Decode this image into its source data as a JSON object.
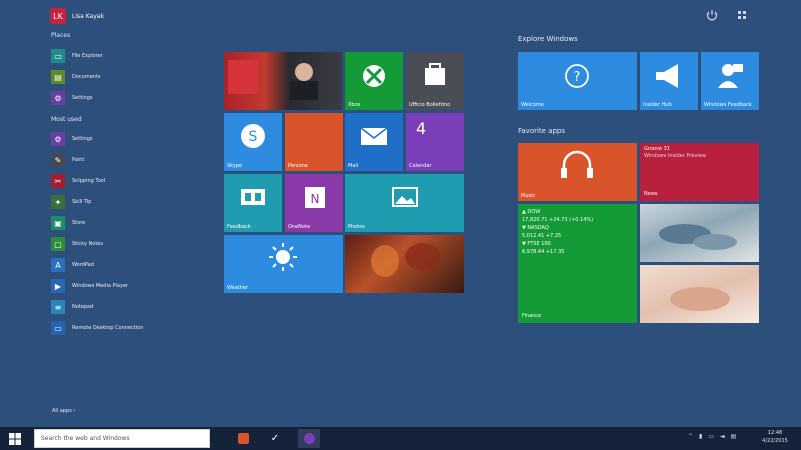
{
  "user": {
    "name": "Lisa Kayak",
    "avatar_initials": "LK"
  },
  "left_menu": {
    "sections": [
      {
        "title": "Places",
        "items": [
          {
            "label": "File Explorer",
            "icon": "folder-icon",
            "color": "#1e8d8a"
          },
          {
            "label": "Documents",
            "icon": "documents-icon",
            "color": "#5f8a2b"
          },
          {
            "label": "Settings",
            "icon": "gear-icon",
            "color": "#6b3fa0"
          }
        ]
      },
      {
        "title": "Most used",
        "items": [
          {
            "label": "Settings",
            "icon": "gear-icon",
            "color": "#6b3fa0"
          },
          {
            "label": "Paint",
            "icon": "paint-icon",
            "color": "#444a52"
          },
          {
            "label": "Snipping Tool",
            "icon": "scissors-icon",
            "color": "#a21d2e"
          },
          {
            "label": "Skill Tip",
            "icon": "tip-icon",
            "color": "#3a6e3a"
          },
          {
            "label": "Store",
            "icon": "store-icon",
            "color": "#1b8d6d"
          },
          {
            "label": "Sticky Notes",
            "icon": "note-icon",
            "color": "#2f8d3a"
          },
          {
            "label": "WordPad",
            "icon": "wordpad-icon",
            "color": "#2d6fbf"
          },
          {
            "label": "Windows Media Player",
            "icon": "media-icon",
            "color": "#2a66b4"
          },
          {
            "label": "Notepad",
            "icon": "notepad-icon",
            "color": "#2a85b8"
          },
          {
            "label": "Remote Desktop Connection",
            "icon": "remote-icon",
            "color": "#2563b0"
          }
        ]
      }
    ],
    "all_apps": "All apps  ›"
  },
  "colors": {
    "background": "#2d4f7c",
    "taskbar": "#15233a",
    "blue_tile": "#2d8ce0",
    "green_tile": "#149a36",
    "orange_tile": "#d9542a",
    "purple_tile": "#7a3fb8",
    "teal_tile": "#1f9cb0",
    "red_tile": "#b8203d"
  },
  "tiles_left": {
    "news_photo": "",
    "xbox": "Xbox",
    "store": "Ufficio Bollettino",
    "skype": "Skype",
    "people": "Persone",
    "mail": "Mail",
    "calendar": "Calendar",
    "calendar_date": "4",
    "feedback": "Feedback",
    "onenote": "OneNote",
    "photos": "Photos",
    "weather": "Weather"
  },
  "explore": {
    "title": "Explore Windows",
    "tiles": [
      "Welcome",
      "Insider Hub",
      "Windows Feedback"
    ]
  },
  "favorites": {
    "title": "Favorite apps",
    "music": "Music",
    "news_title": "Groove 31",
    "news_line1": "Windows Insider Preview",
    "news_line2": "News",
    "stock": {
      "line1": "▲ DOW",
      "line2": "17,820.71  +24.73  (+0.14%)",
      "line3": "▼ NASDAQ",
      "line4": "5,012.41  +7.25",
      "line5": "▼ FTSE 100",
      "line6": "6,978.44  +17.35",
      "label": "Finance"
    }
  },
  "taskbar": {
    "search_placeholder": "Search the web and Windows",
    "clock_time": "12:48",
    "clock_date": "4/22/2015"
  }
}
